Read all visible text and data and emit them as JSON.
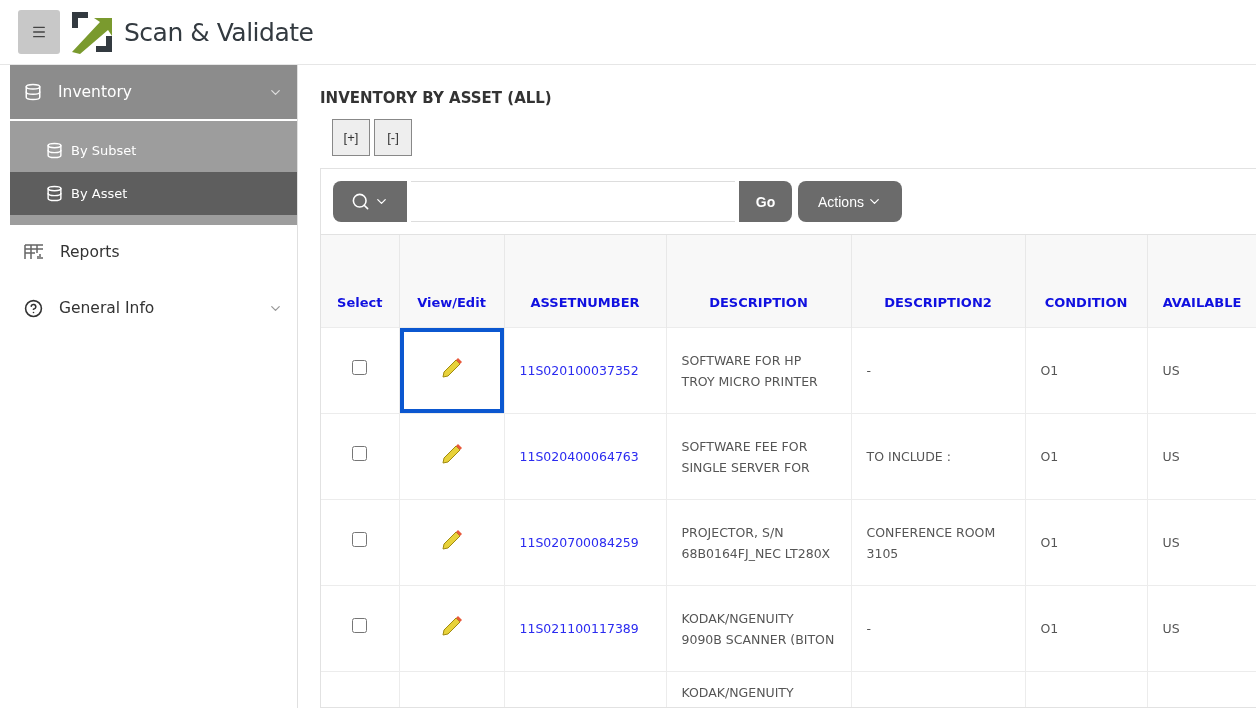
{
  "header": {
    "app_title": "Scan & Validate"
  },
  "sidebar": {
    "items": [
      {
        "label": "Inventory",
        "kind": "database",
        "expanded": true,
        "children": [
          {
            "label": "By Subset",
            "selected": false
          },
          {
            "label": "By Asset",
            "selected": true
          }
        ]
      },
      {
        "label": "Reports",
        "kind": "report",
        "expanded": false,
        "has_children": false
      },
      {
        "label": "General Info",
        "kind": "help",
        "expanded": false,
        "has_children": true
      }
    ]
  },
  "region": {
    "title": "INVENTORY BY ASSET (ALL)",
    "expand_buttons": [
      "[+]",
      "[-]"
    ],
    "toolbar": {
      "go": "Go",
      "actions": "Actions"
    },
    "table": {
      "columns": [
        "Select",
        "View/Edit",
        "ASSETNUMBER",
        "DESCRIPTION",
        "DESCRIPTION2",
        "CONDITION",
        "AVAILABLE"
      ],
      "rows": [
        {
          "checked": false,
          "focused": true,
          "asset": "11S020100037352",
          "description": "SOFTWARE FOR HP TROY MICRO PRINTER",
          "description2": "-",
          "condition": "O1",
          "available": "US"
        },
        {
          "checked": false,
          "focused": false,
          "asset": "11S020400064763",
          "description": "SOFTWARE FEE FOR SINGLE SERVER FOR",
          "description2": "TO INCLUDE :",
          "condition": "O1",
          "available": "US"
        },
        {
          "checked": false,
          "focused": false,
          "asset": "11S020700084259",
          "description": "PROJECTOR, S/N 68B0164FJ_NEC LT280X",
          "description2": "CONFERENCE ROOM 3105",
          "condition": "O1",
          "available": "US"
        },
        {
          "checked": false,
          "focused": false,
          "asset": "11S021100117389",
          "description": "KODAK/NGENUITY 9090B SCANNER (BITON",
          "description2": "-",
          "condition": "O1",
          "available": "US"
        },
        {
          "kind": "partial",
          "description": "KODAK/NGENUITY"
        }
      ]
    }
  }
}
